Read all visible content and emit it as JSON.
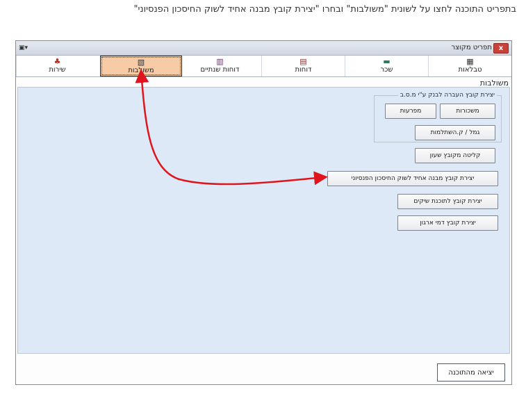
{
  "instruction": "בתפריט התוכנה לחצו על לשונית \"משולבות\" ובחרו \"יצירת קובץ מבנה אחיד לשוק החיסכון הפנסיוני\"",
  "window": {
    "title": "תפריט מקוצר",
    "close_label": "x",
    "sys_label": "▣▾"
  },
  "tabs": [
    {
      "key": "tables",
      "label": "טבלאות",
      "icon": "table-icon",
      "glyph": "▦"
    },
    {
      "key": "salary",
      "label": "שכר",
      "icon": "salary-icon",
      "glyph": "▬"
    },
    {
      "key": "reports",
      "label": "דוחות",
      "icon": "reports-icon",
      "glyph": "▤"
    },
    {
      "key": "annual_reports",
      "label": "דוחות שנתיים",
      "icon": "annual-reports-icon",
      "glyph": "▥"
    },
    {
      "key": "combined",
      "label": "משולבות",
      "icon": "combined-icon",
      "glyph": "▧",
      "active": true
    },
    {
      "key": "services",
      "label": "שירות",
      "icon": "services-icon",
      "glyph": "♣"
    }
  ],
  "section_label": "משולבות",
  "group": {
    "legend": "יצירת קובץ העברה לבנק ע\"י מ.ס.ב",
    "btn_salaries": "משכורות",
    "btn_advances": "מפרעות",
    "btn_gemel": "גמל / ק.השתלמות"
  },
  "buttons": {
    "import_old": "קליטה מקובץ שעון",
    "pension_file": "יצירת קובץ מבנה אחיד לשוק החיסכון הפנסיוני",
    "marketing_file": "יצירת קובץ לתוכנת שיקים",
    "dues_file": "יצירת קובץ דמי ארגון"
  },
  "exit_label": "יציאה מהתוכנה",
  "colors": {
    "arrow": "#e0141c",
    "active_tab": "#f6cba6",
    "panel": "#dde9f6"
  }
}
